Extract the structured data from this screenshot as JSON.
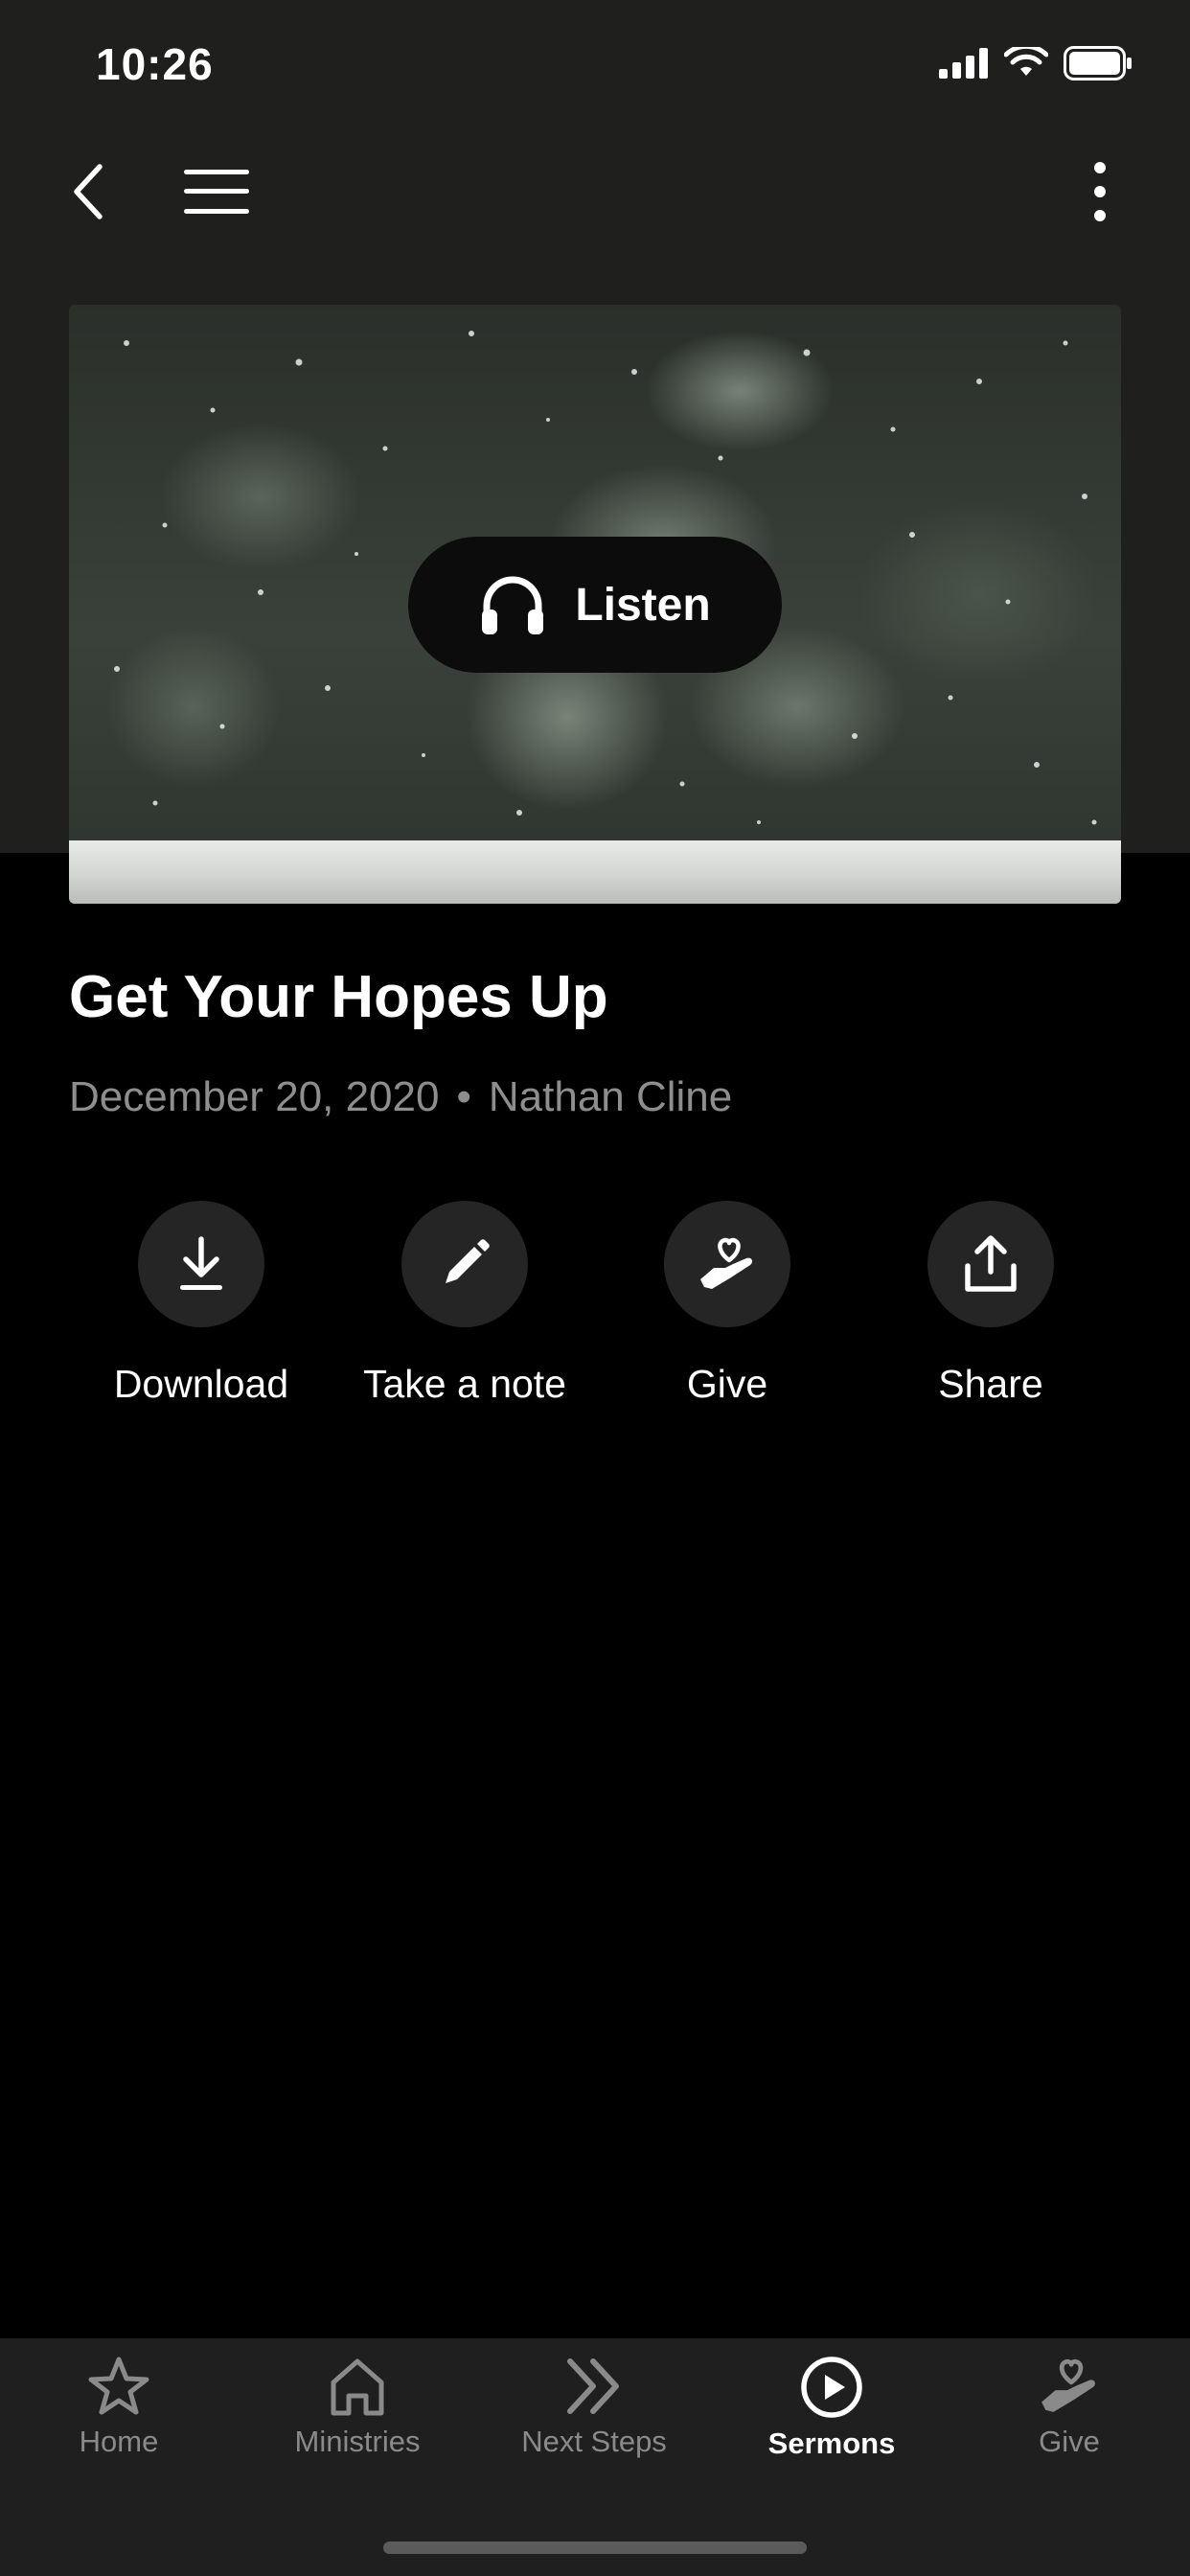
{
  "status_bar": {
    "time": "10:26"
  },
  "nav": {
    "back_icon": "chevron-left-icon",
    "menu_icon": "hamburger-menu-icon",
    "more_icon": "more-vertical-icon"
  },
  "hero": {
    "listen_label": "Listen",
    "listen_icon": "headphones-icon"
  },
  "sermon": {
    "title": "Get Your Hopes Up",
    "date": "December 20, 2020",
    "separator": "•",
    "speaker": "Nathan Cline"
  },
  "actions": [
    {
      "label": "Download",
      "icon": "download-icon"
    },
    {
      "label": "Take a note",
      "icon": "pencil-icon"
    },
    {
      "label": "Give",
      "icon": "hand-heart-icon"
    },
    {
      "label": "Share",
      "icon": "share-icon"
    }
  ],
  "tabs": [
    {
      "label": "Home",
      "icon": "star-icon",
      "active": false
    },
    {
      "label": "Ministries",
      "icon": "house-icon",
      "active": false
    },
    {
      "label": "Next Steps",
      "icon": "double-chevron-icon",
      "active": false
    },
    {
      "label": "Sermons",
      "icon": "play-circle-icon",
      "active": true
    },
    {
      "label": "Give",
      "icon": "hand-heart-icon",
      "active": false
    }
  ],
  "colors": {
    "header_bg": "#1f201d",
    "page_bg": "#000000",
    "tab_bar_bg": "#1f1f1f",
    "muted_text": "#8e8e8e",
    "action_circle": "#252525"
  }
}
